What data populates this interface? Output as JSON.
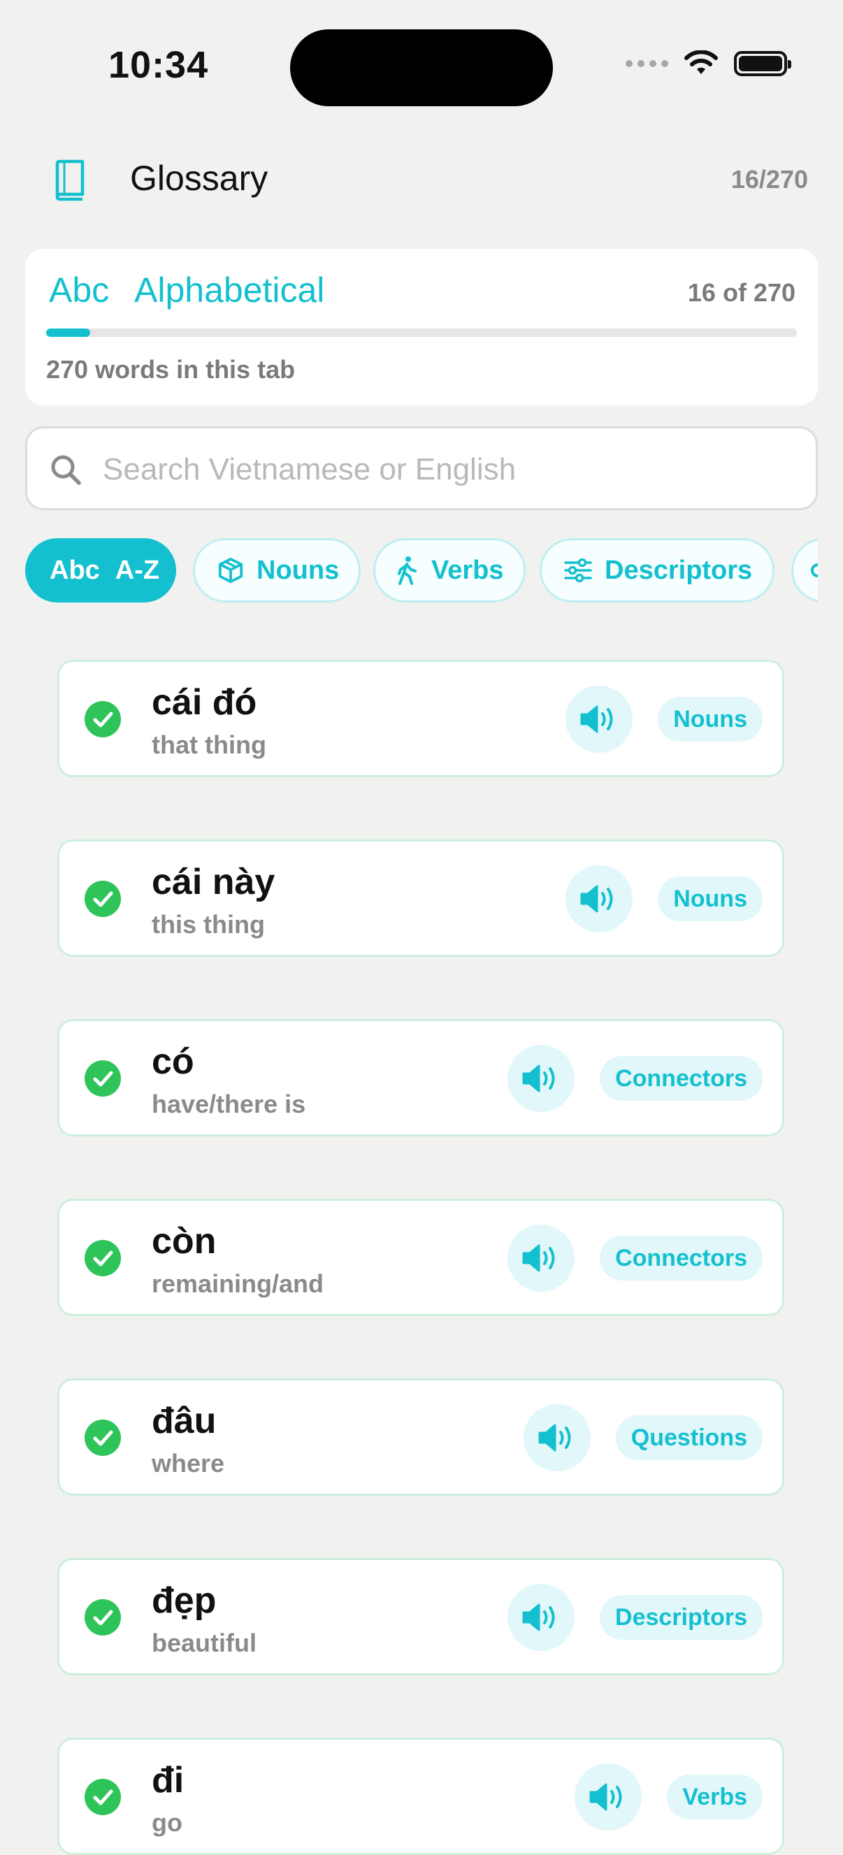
{
  "status": {
    "time": "10:34"
  },
  "header": {
    "title": "Glossary",
    "count": "16/270"
  },
  "tab": {
    "abc": "Abc",
    "name": "Alphabetical",
    "progress_text": "16 of 270",
    "progress_fraction": 0.059,
    "subtitle": "270 words in this tab"
  },
  "search": {
    "placeholder": "Search Vietnamese or English"
  },
  "filters": [
    {
      "abc": "Abc",
      "label": "A-Z",
      "icon": "abc-icon",
      "active": true
    },
    {
      "label": "Nouns",
      "icon": "cube-icon",
      "active": false
    },
    {
      "label": "Verbs",
      "icon": "walking-icon",
      "active": false
    },
    {
      "label": "Descriptors",
      "icon": "sliders-icon",
      "active": false
    }
  ],
  "words": [
    {
      "vi": "cái đó",
      "en": "that thing",
      "category": "Nouns",
      "learned": true
    },
    {
      "vi": "cái này",
      "en": "this thing",
      "category": "Nouns",
      "learned": true
    },
    {
      "vi": "có",
      "en": "have/there is",
      "category": "Connectors",
      "learned": true
    },
    {
      "vi": "còn",
      "en": "remaining/and",
      "category": "Connectors",
      "learned": true
    },
    {
      "vi": "đâu",
      "en": "where",
      "category": "Questions",
      "learned": true
    },
    {
      "vi": "đẹp",
      "en": "beautiful",
      "category": "Descriptors",
      "learned": true
    },
    {
      "vi": "đi",
      "en": "go",
      "category": "Verbs",
      "learned": true
    }
  ],
  "colors": {
    "accent": "#14c0cf",
    "success": "#2ec45a",
    "background": "#f1f2f0"
  }
}
